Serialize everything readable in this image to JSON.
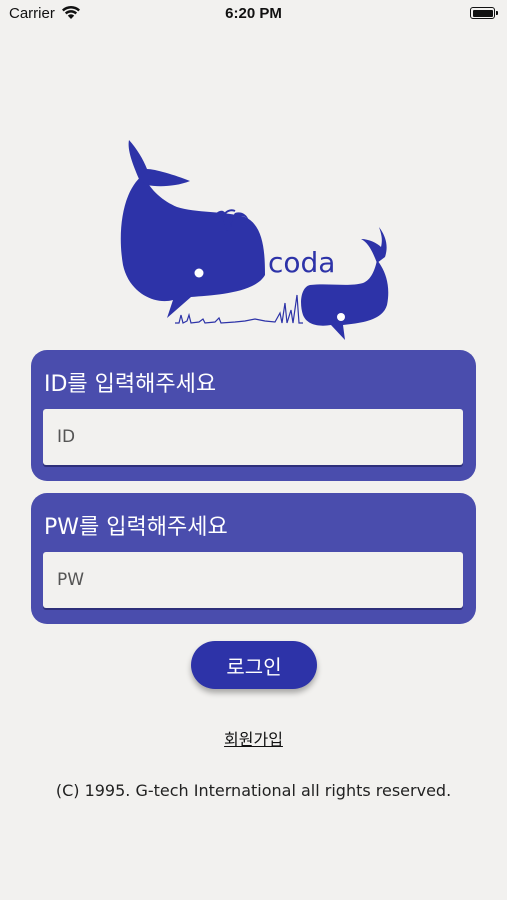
{
  "status_bar": {
    "carrier": "Carrier",
    "time": "6:20 PM"
  },
  "logo": {
    "text": "coda",
    "brand_color": "#2d33a8"
  },
  "id_field": {
    "title": "ID를 입력해주세요",
    "placeholder": "ID",
    "value": ""
  },
  "pw_field": {
    "title": "PW를 입력해주세요",
    "placeholder": "PW",
    "value": ""
  },
  "login_button": {
    "label": "로그인"
  },
  "signup_link": {
    "label": "회원가입"
  },
  "footer": {
    "copyright": "(C) 1995. G-tech International all rights reserved."
  },
  "colors": {
    "card": "#4a4dad",
    "button": "#2d33a8",
    "background": "#f2f1ef"
  }
}
